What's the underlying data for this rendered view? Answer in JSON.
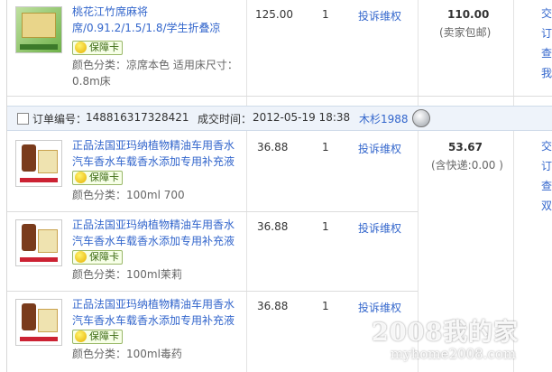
{
  "order1": {
    "item": {
      "title": "桃花江竹席麻将席/0.91.2/1.5/1.8/学生折叠凉",
      "badge": "保障卡",
      "attr": "颜色分类：凉席本色 适用床尺寸：0.8m床",
      "price": "125.00",
      "qty": "1",
      "complain": "投诉维权"
    },
    "total": "110.00",
    "shipping": "(卖家包邮)",
    "status_lines": [
      "交",
      "订",
      "查",
      "我"
    ]
  },
  "order2": {
    "order_no_label": "订单编号：",
    "order_no": "148816317328421",
    "time_label": "成交时间：",
    "time": "2012-05-19 18:38",
    "seller": "木杉1988",
    "total": "53.67",
    "shipping": "(含快递:0.00 )",
    "status_lines": [
      "交",
      "订",
      "查",
      "双"
    ],
    "items": [
      {
        "title": "正品法国亚玛纳植物精油车用香水汽车香水车载香水添加专用补充液",
        "badge": "保障卡",
        "attr": "颜色分类：100ml 700",
        "price": "36.88",
        "qty": "1",
        "complain": "投诉维权"
      },
      {
        "title": "正品法国亚玛纳植物精油车用香水汽车香水车载香水添加专用补充液",
        "badge": "保障卡",
        "attr": "颜色分类：100ml茉莉",
        "price": "36.88",
        "qty": "1",
        "complain": "投诉维权"
      },
      {
        "title": "正品法国亚玛纳植物精油车用香水汽车香水车载香水添加专用补充液",
        "badge": "保障卡",
        "attr": "颜色分类：100ml毒药",
        "price": "36.88",
        "qty": "1",
        "complain": "投诉维权"
      }
    ]
  },
  "watermark": {
    "main": "2008我的家",
    "url": "myhome2008.com"
  }
}
